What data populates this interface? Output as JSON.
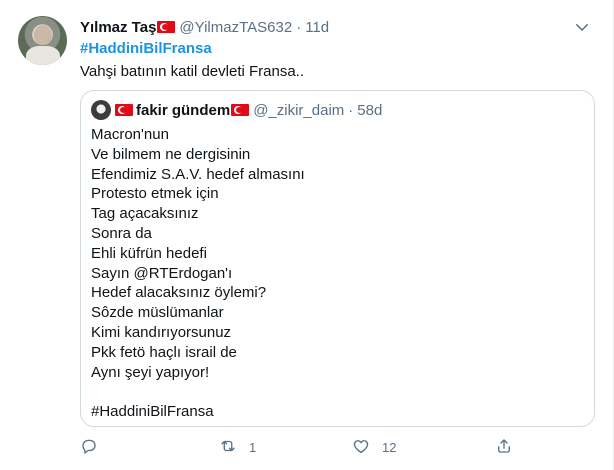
{
  "tweet": {
    "author_name": "Yılmaz Taş",
    "handle": "@YilmazTAS632",
    "separator": "·",
    "time": "11d",
    "hashtag": "#HaddiniBilFransa",
    "text": "Vahşi batının katil devleti Fransa.."
  },
  "quote": {
    "author_name": "fakir gündem",
    "handle": "@_zikir_daim",
    "separator": "·",
    "time": "58d",
    "lines": [
      "Macron'nun",
      "Ve bilmem ne dergisinin",
      "Efendimiz S.A.V. hedef almasını",
      "Protesto etmek için",
      "Tag açacaksınız",
      "Sonra da",
      "Ehli küfrün hedefi",
      "Sayın @RTErdogan'ı",
      "Hedef alacaksınız öylemi?",
      "Sôzde müslümanlar",
      "Kimi kandırıyorsunuz",
      "Pkk fetö haçlı israil de",
      "Aynı şeyi yapıyor!",
      "",
      "#HaddiniBilFransa"
    ]
  },
  "actions": {
    "reply_count": "",
    "retweet_count": "1",
    "like_count": "12"
  },
  "icons": [
    "caret-down-icon",
    "reply-icon",
    "retweet-icon",
    "like-icon",
    "share-icon",
    "turkish-flag-icon"
  ],
  "colors": {
    "link": "#1b95e0",
    "muted": "#5b7083",
    "border": "#cfd9de",
    "flag": "#e30a17"
  }
}
